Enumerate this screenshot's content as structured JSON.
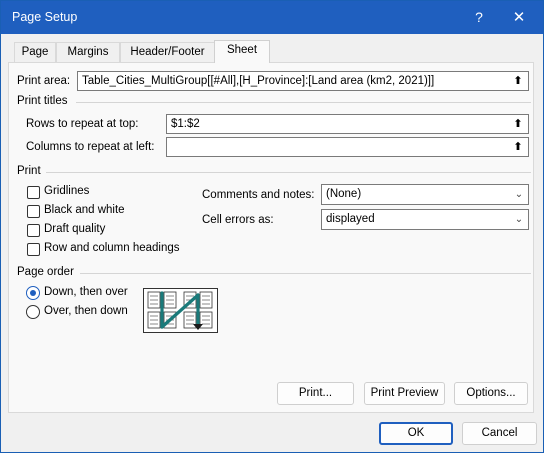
{
  "window": {
    "title": "Page Setup"
  },
  "titlebar": {
    "help_label": "?",
    "close_label": "✕"
  },
  "tabs": [
    {
      "label": "Page"
    },
    {
      "label": "Margins"
    },
    {
      "label": "Header/Footer"
    },
    {
      "label": "Sheet",
      "active": true
    }
  ],
  "print_area": {
    "label": "Print area:",
    "value": "Table_Cities_MultiGroup[[#All],[H_Province]:[Land area (km2, 2021)]]"
  },
  "print_titles": {
    "heading": "Print titles",
    "rows_label": "Rows to repeat at top:",
    "rows_value": "$1:$2",
    "columns_label": "Columns to repeat at left:",
    "columns_value": ""
  },
  "print": {
    "heading": "Print",
    "gridlines": {
      "label": "Gridlines",
      "checked": false
    },
    "black_and_white": {
      "label": "Black and white",
      "checked": false
    },
    "draft_quality": {
      "label": "Draft quality",
      "checked": false
    },
    "row_col_headings": {
      "label": "Row and column headings",
      "checked": false
    },
    "comments_label": "Comments and notes:",
    "comments_value": "(None)",
    "cell_errors_label": "Cell errors as:",
    "cell_errors_value": "displayed"
  },
  "page_order": {
    "heading": "Page order",
    "down_then_over": {
      "label": "Down, then over",
      "selected": true
    },
    "over_then_down": {
      "label": "Over, then down",
      "selected": false
    }
  },
  "buttons": {
    "print": "Print...",
    "print_preview": "Print Preview",
    "options": "Options...",
    "ok": "OK",
    "cancel": "Cancel"
  },
  "colors": {
    "accent": "#1f5fbf",
    "arrow": "#1a7a7a"
  },
  "icons": {
    "collapse": "collapse-dialog-icon",
    "dropdown": "chevron-down-icon"
  }
}
